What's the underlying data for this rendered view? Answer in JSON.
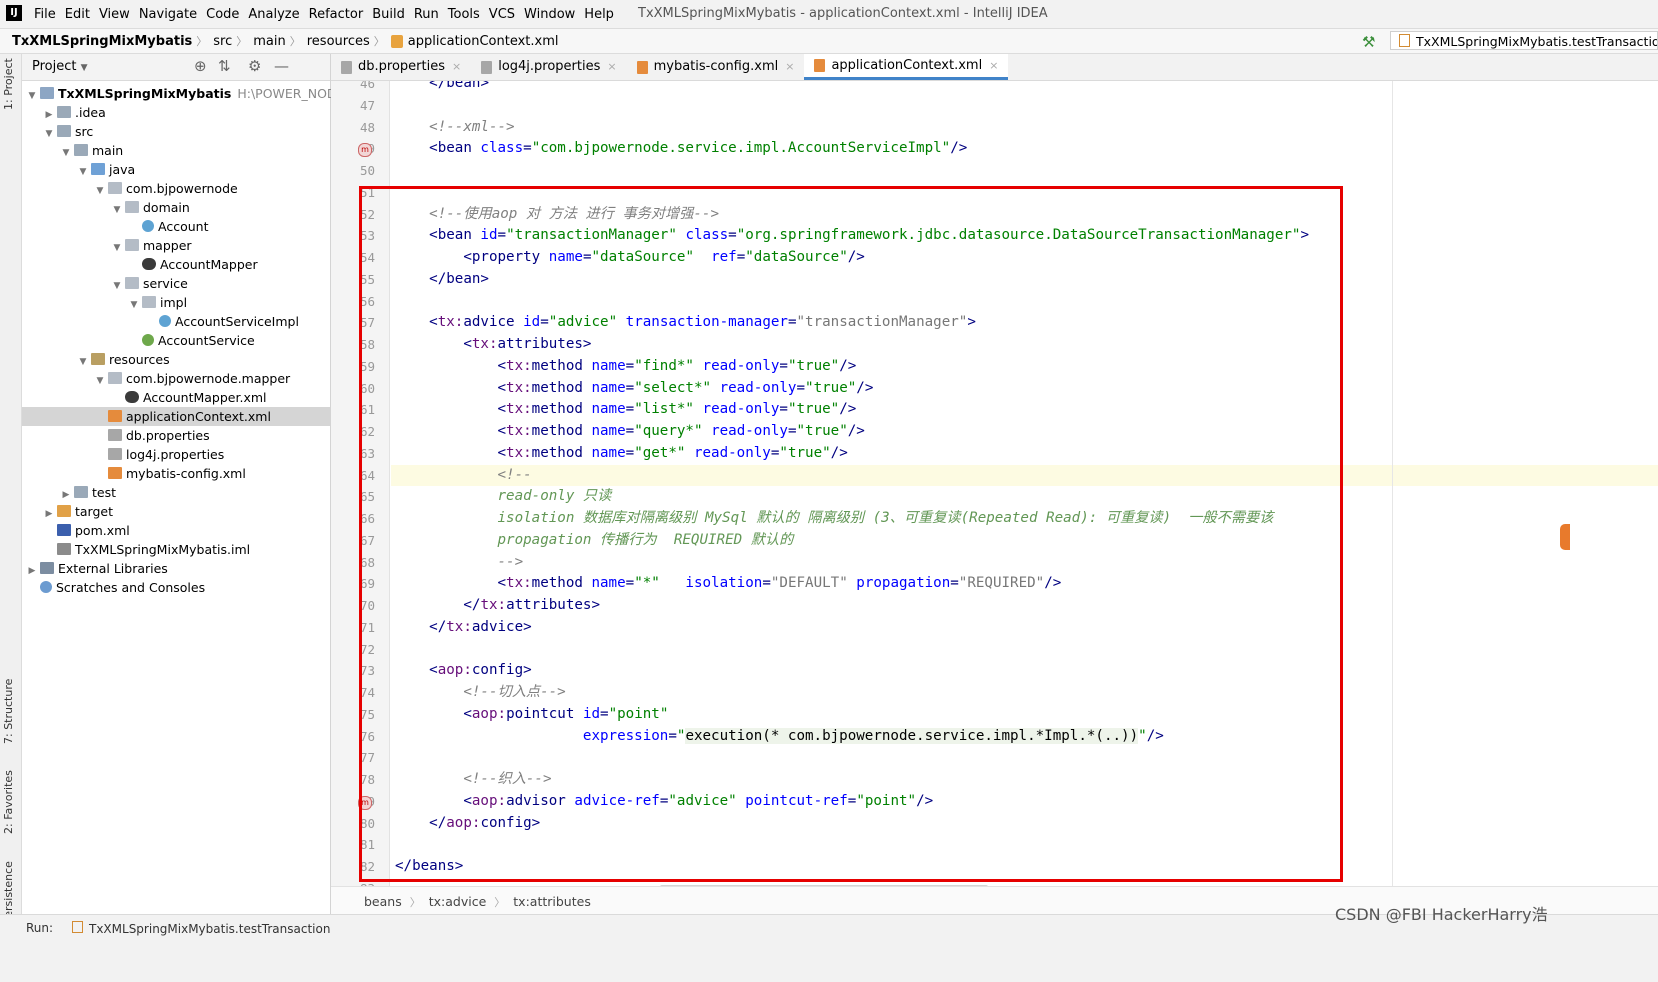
{
  "menubar": {
    "items": [
      "File",
      "Edit",
      "View",
      "Navigate",
      "Code",
      "Analyze",
      "Refactor",
      "Build",
      "Run",
      "Tools",
      "VCS",
      "Window",
      "Help"
    ],
    "title": "TxXMLSpringMixMybatis - applicationContext.xml - IntelliJ IDEA"
  },
  "navbar": {
    "breadcrumb": [
      "TxXMLSpringMixMybatis",
      "src",
      "main",
      "resources",
      "applicationContext.xml"
    ],
    "run_config": "TxXMLSpringMixMybatis.testTransaction"
  },
  "left_stripe": {
    "project": "1: Project",
    "structure": "7: Structure",
    "favorites": "2: Favorites",
    "persistence": "Persistence"
  },
  "project_panel": {
    "view_label": "Project",
    "tree": [
      {
        "label": "TxXMLSpringMixMybatis",
        "extra": "H:\\POWER_NODE",
        "depth": 0,
        "arrow": "down",
        "icon": "module",
        "bold": true
      },
      {
        "label": ".idea",
        "depth": 1,
        "arrow": "right",
        "icon": "folder"
      },
      {
        "label": "src",
        "depth": 1,
        "arrow": "down",
        "icon": "folder"
      },
      {
        "label": "main",
        "depth": 2,
        "arrow": "down",
        "icon": "folder"
      },
      {
        "label": "java",
        "depth": 3,
        "arrow": "down",
        "icon": "src"
      },
      {
        "label": "com.bjpowernode",
        "depth": 4,
        "arrow": "down",
        "icon": "pkg"
      },
      {
        "label": "domain",
        "depth": 5,
        "arrow": "down",
        "icon": "pkg"
      },
      {
        "label": "Account",
        "depth": 6,
        "arrow": "",
        "icon": "class"
      },
      {
        "label": "mapper",
        "depth": 5,
        "arrow": "down",
        "icon": "pkg"
      },
      {
        "label": "AccountMapper",
        "depth": 6,
        "arrow": "",
        "icon": "mapper"
      },
      {
        "label": "service",
        "depth": 5,
        "arrow": "down",
        "icon": "pkg"
      },
      {
        "label": "impl",
        "depth": 6,
        "arrow": "down",
        "icon": "pkg"
      },
      {
        "label": "AccountServiceImpl",
        "depth": 7,
        "arrow": "",
        "icon": "class"
      },
      {
        "label": "AccountService",
        "depth": 6,
        "arrow": "",
        "icon": "iface"
      },
      {
        "label": "resources",
        "depth": 3,
        "arrow": "down",
        "icon": "res"
      },
      {
        "label": "com.bjpowernode.mapper",
        "depth": 4,
        "arrow": "down",
        "icon": "pkg"
      },
      {
        "label": "AccountMapper.xml",
        "depth": 5,
        "arrow": "",
        "icon": "mapper"
      },
      {
        "label": "applicationContext.xml",
        "depth": 4,
        "arrow": "",
        "icon": "xml",
        "selected": true
      },
      {
        "label": "db.properties",
        "depth": 4,
        "arrow": "",
        "icon": "props"
      },
      {
        "label": "log4j.properties",
        "depth": 4,
        "arrow": "",
        "icon": "props"
      },
      {
        "label": "mybatis-config.xml",
        "depth": 4,
        "arrow": "",
        "icon": "xml"
      },
      {
        "label": "test",
        "depth": 2,
        "arrow": "right",
        "icon": "folder"
      },
      {
        "label": "target",
        "depth": 1,
        "arrow": "right",
        "icon": "target"
      },
      {
        "label": "pom.xml",
        "depth": 1,
        "arrow": "",
        "icon": "pom"
      },
      {
        "label": "TxXMLSpringMixMybatis.iml",
        "depth": 1,
        "arrow": "",
        "icon": "iml"
      },
      {
        "label": "External Libraries",
        "depth": 0,
        "arrow": "right",
        "icon": "lib"
      },
      {
        "label": "Scratches and Consoles",
        "depth": 0,
        "arrow": "",
        "icon": "scratch"
      }
    ]
  },
  "editor_tabs": [
    {
      "label": "db.properties",
      "icon": "props"
    },
    {
      "label": "log4j.properties",
      "icon": "props"
    },
    {
      "label": "mybatis-config.xml",
      "icon": "xml"
    },
    {
      "label": "applicationContext.xml",
      "icon": "xml",
      "active": true
    }
  ],
  "code": {
    "first_line": 46,
    "lines": [
      [
        [
          "    ",
          ""
        ],
        [
          "</",
          "c-tag"
        ],
        [
          "bean",
          "c-tag"
        ],
        [
          ">",
          "c-tag"
        ]
      ],
      [],
      [
        [
          "    ",
          ""
        ],
        [
          "<!--xml-->",
          "c-com"
        ]
      ],
      [
        [
          "    ",
          ""
        ],
        [
          "<bean ",
          "c-tag"
        ],
        [
          "class",
          "c-attr"
        ],
        [
          "=",
          "c-tag"
        ],
        [
          "\"com.bjpowernode.service.impl.AccountServiceImpl\"",
          "c-val"
        ],
        [
          "/>",
          "c-tag"
        ]
      ],
      [],
      [],
      [
        [
          "    ",
          ""
        ],
        [
          "<!--使用aop 对 方法 进行 事务对增强-->",
          "c-com"
        ]
      ],
      [
        [
          "    ",
          ""
        ],
        [
          "<bean ",
          "c-tag"
        ],
        [
          "id",
          "c-attr"
        ],
        [
          "=",
          "c-tag"
        ],
        [
          "\"transactionManager\"",
          "c-val"
        ],
        [
          " class",
          "c-attr"
        ],
        [
          "=",
          "c-tag"
        ],
        [
          "\"org.springframework.jdbc.datasource.DataSourceTransactionManager\"",
          "c-val"
        ],
        [
          ">",
          "c-tag"
        ]
      ],
      [
        [
          "        ",
          ""
        ],
        [
          "<property ",
          "c-tag"
        ],
        [
          "name",
          "c-attr"
        ],
        [
          "=",
          "c-tag"
        ],
        [
          "\"dataSource\"",
          "c-val"
        ],
        [
          "  ref",
          "c-attr"
        ],
        [
          "=",
          "c-tag"
        ],
        [
          "\"dataSource\"",
          "c-val"
        ],
        [
          "/>",
          "c-tag"
        ]
      ],
      [
        [
          "    ",
          ""
        ],
        [
          "</bean>",
          "c-tag"
        ]
      ],
      [],
      [
        [
          "    ",
          ""
        ],
        [
          "<",
          "c-tag"
        ],
        [
          "tx:",
          "c-ns"
        ],
        [
          "advice ",
          "c-tag"
        ],
        [
          "id",
          "c-attr"
        ],
        [
          "=",
          "c-tag"
        ],
        [
          "\"advice\"",
          "c-val"
        ],
        [
          " transaction-manager",
          "c-attr"
        ],
        [
          "=",
          "c-tag"
        ],
        [
          "\"transactionManager\"",
          "c-gray"
        ],
        [
          ">",
          "c-tag"
        ]
      ],
      [
        [
          "        ",
          ""
        ],
        [
          "<",
          "c-tag"
        ],
        [
          "tx:",
          "c-ns"
        ],
        [
          "attributes>",
          "c-tag"
        ]
      ],
      [
        [
          "            ",
          ""
        ],
        [
          "<",
          "c-tag"
        ],
        [
          "tx:",
          "c-ns"
        ],
        [
          "method ",
          "c-tag"
        ],
        [
          "name",
          "c-attr"
        ],
        [
          "=",
          "c-tag"
        ],
        [
          "\"find*\"",
          "c-val"
        ],
        [
          " read-only",
          "c-attr"
        ],
        [
          "=",
          "c-tag"
        ],
        [
          "\"true\"",
          "c-val"
        ],
        [
          "/>",
          "c-tag"
        ]
      ],
      [
        [
          "            ",
          ""
        ],
        [
          "<",
          "c-tag"
        ],
        [
          "tx:",
          "c-ns"
        ],
        [
          "method ",
          "c-tag"
        ],
        [
          "name",
          "c-attr"
        ],
        [
          "=",
          "c-tag"
        ],
        [
          "\"select*\"",
          "c-val"
        ],
        [
          " read-only",
          "c-attr"
        ],
        [
          "=",
          "c-tag"
        ],
        [
          "\"true\"",
          "c-val"
        ],
        [
          "/>",
          "c-tag"
        ]
      ],
      [
        [
          "            ",
          ""
        ],
        [
          "<",
          "c-tag"
        ],
        [
          "tx:",
          "c-ns"
        ],
        [
          "method ",
          "c-tag"
        ],
        [
          "name",
          "c-attr"
        ],
        [
          "=",
          "c-tag"
        ],
        [
          "\"list*\"",
          "c-val"
        ],
        [
          " read-only",
          "c-attr"
        ],
        [
          "=",
          "c-tag"
        ],
        [
          "\"true\"",
          "c-val"
        ],
        [
          "/>",
          "c-tag"
        ]
      ],
      [
        [
          "            ",
          ""
        ],
        [
          "<",
          "c-tag"
        ],
        [
          "tx:",
          "c-ns"
        ],
        [
          "method ",
          "c-tag"
        ],
        [
          "name",
          "c-attr"
        ],
        [
          "=",
          "c-tag"
        ],
        [
          "\"query*\"",
          "c-val"
        ],
        [
          " read-only",
          "c-attr"
        ],
        [
          "=",
          "c-tag"
        ],
        [
          "\"true\"",
          "c-val"
        ],
        [
          "/>",
          "c-tag"
        ]
      ],
      [
        [
          "            ",
          ""
        ],
        [
          "<",
          "c-tag"
        ],
        [
          "tx:",
          "c-ns"
        ],
        [
          "method ",
          "c-tag"
        ],
        [
          "name",
          "c-attr"
        ],
        [
          "=",
          "c-tag"
        ],
        [
          "\"get*\"",
          "c-val"
        ],
        [
          " read-only",
          "c-attr"
        ],
        [
          "=",
          "c-tag"
        ],
        [
          "\"true\"",
          "c-val"
        ],
        [
          "/>",
          "c-tag"
        ]
      ],
      [
        [
          "            ",
          ""
        ],
        [
          "<!--",
          "c-com"
        ]
      ],
      [
        [
          "            ",
          ""
        ],
        [
          "read-only 只读",
          "c-doc"
        ]
      ],
      [
        [
          "            ",
          ""
        ],
        [
          "isolation 数据库对隔离级别 MySql 默认的 隔离级别 (3、可重复读(Repeated Read): 可重复读)  一般不需要该",
          "c-doc"
        ]
      ],
      [
        [
          "            ",
          ""
        ],
        [
          "propagation 传播行为  REQUIRED 默认的",
          "c-doc"
        ]
      ],
      [
        [
          "            ",
          ""
        ],
        [
          "-->",
          "c-com"
        ]
      ],
      [
        [
          "            ",
          ""
        ],
        [
          "<",
          "c-tag"
        ],
        [
          "tx:",
          "c-ns"
        ],
        [
          "method ",
          "c-tag"
        ],
        [
          "name",
          "c-attr"
        ],
        [
          "=",
          "c-tag"
        ],
        [
          "\"*\"",
          "c-val"
        ],
        [
          "   isolation",
          "c-attr"
        ],
        [
          "=",
          "c-tag"
        ],
        [
          "\"DEFAULT\"",
          "c-gray"
        ],
        [
          " propagation",
          "c-attr"
        ],
        [
          "=",
          "c-tag"
        ],
        [
          "\"REQUIRED\"",
          "c-gray"
        ],
        [
          "/>",
          "c-tag"
        ]
      ],
      [
        [
          "        ",
          ""
        ],
        [
          "</",
          "c-tag"
        ],
        [
          "tx:",
          "c-ns"
        ],
        [
          "attributes>",
          "c-tag"
        ]
      ],
      [
        [
          "    ",
          ""
        ],
        [
          "</",
          "c-tag"
        ],
        [
          "tx:",
          "c-ns"
        ],
        [
          "advice>",
          "c-tag"
        ]
      ],
      [],
      [
        [
          "    ",
          ""
        ],
        [
          "<",
          "c-tag"
        ],
        [
          "aop:",
          "c-ns"
        ],
        [
          "config>",
          "c-tag"
        ]
      ],
      [
        [
          "        ",
          ""
        ],
        [
          "<!--切入点-->",
          "c-com"
        ]
      ],
      [
        [
          "        ",
          ""
        ],
        [
          "<",
          "c-tag"
        ],
        [
          "aop:",
          "c-ns"
        ],
        [
          "pointcut ",
          "c-tag"
        ],
        [
          "id",
          "c-attr"
        ],
        [
          "=",
          "c-tag"
        ],
        [
          "\"point\"",
          "c-val"
        ]
      ],
      [
        [
          "                      ",
          ""
        ],
        [
          "expression",
          "c-attr"
        ],
        [
          "=",
          "c-tag"
        ],
        [
          "\"",
          "c-val"
        ],
        [
          "execution(* com.bjpowernode.service.impl.*Impl.*(..))",
          "c-exec"
        ],
        [
          "\"",
          "c-val"
        ],
        [
          "/>",
          "c-tag"
        ]
      ],
      [],
      [
        [
          "        ",
          ""
        ],
        [
          "<!--织入-->",
          "c-com"
        ]
      ],
      [
        [
          "        ",
          ""
        ],
        [
          "<",
          "c-tag"
        ],
        [
          "aop:",
          "c-ns"
        ],
        [
          "advisor ",
          "c-tag"
        ],
        [
          "advice-ref",
          "c-attr"
        ],
        [
          "=",
          "c-tag"
        ],
        [
          "\"advice\"",
          "c-val"
        ],
        [
          " pointcut-ref",
          "c-attr"
        ],
        [
          "=",
          "c-tag"
        ],
        [
          "\"point\"",
          "c-val"
        ],
        [
          "/>",
          "c-tag"
        ]
      ],
      [
        [
          "    ",
          ""
        ],
        [
          "</",
          "c-tag"
        ],
        [
          "aop:",
          "c-ns"
        ],
        [
          "config>",
          "c-tag"
        ]
      ],
      [],
      [
        [
          "",
          ""
        ],
        [
          "</beans>",
          "c-tag"
        ]
      ],
      []
    ],
    "gutter_marks": {
      "49": "m",
      "79": "m"
    },
    "highlight_line": 64
  },
  "bottom_breadcrumb": [
    "beans",
    "tx:advice",
    "tx:attributes"
  ],
  "status": {
    "run_label": "Run:",
    "run_tab": "TxXMLSpringMixMybatis.testTransaction",
    "watermark": "CSDN @FBI HackerHarry浩"
  }
}
